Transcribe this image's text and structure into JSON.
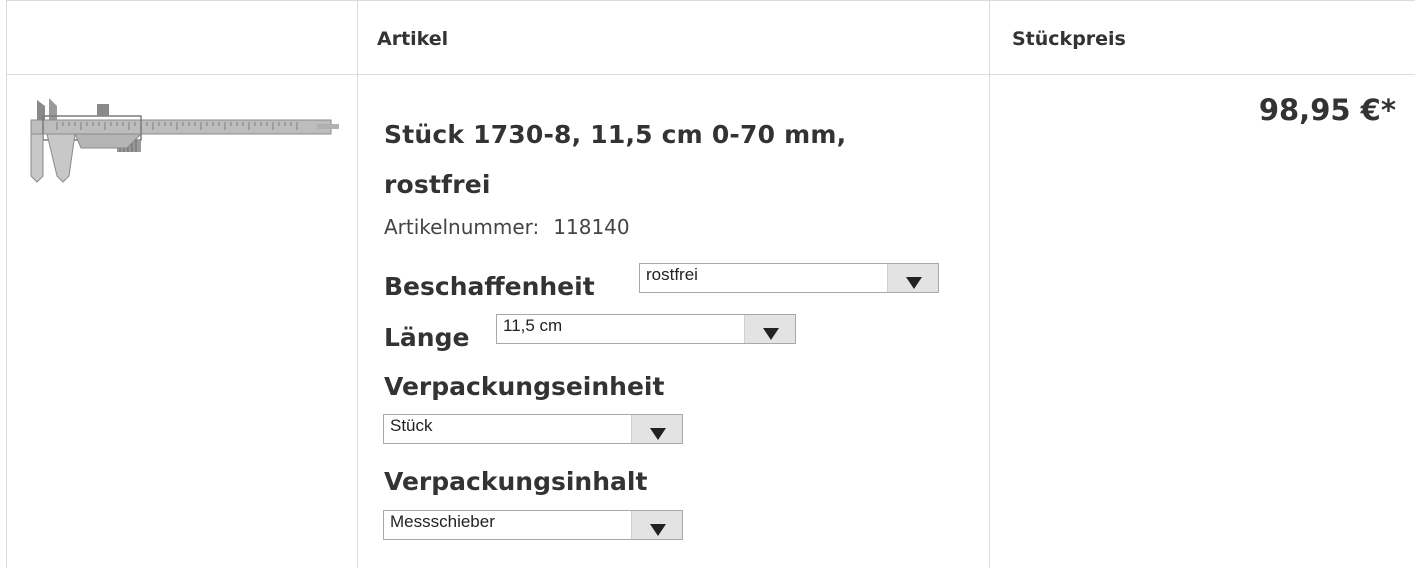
{
  "header": {
    "col_article": "Artikel",
    "col_price": "Stückpreis"
  },
  "product": {
    "image_icon": "caliper-icon",
    "title": "Stück 1730-8, 11,5 cm 0-70 mm, rostfrei",
    "article_number_label": "Artikelnummer:",
    "article_number": "118140",
    "price": "98,95 €*"
  },
  "options": {
    "beschaffenheit": {
      "label": "Beschaffenheit",
      "value": "rostfrei"
    },
    "laenge": {
      "label": "Länge",
      "value": "11,5 cm"
    },
    "verpackungseinheit": {
      "label": "Verpackungseinheit",
      "value": "Stück"
    },
    "verpackungsinhalt": {
      "label": "Verpackungsinhalt",
      "value": "Messschieber"
    }
  }
}
